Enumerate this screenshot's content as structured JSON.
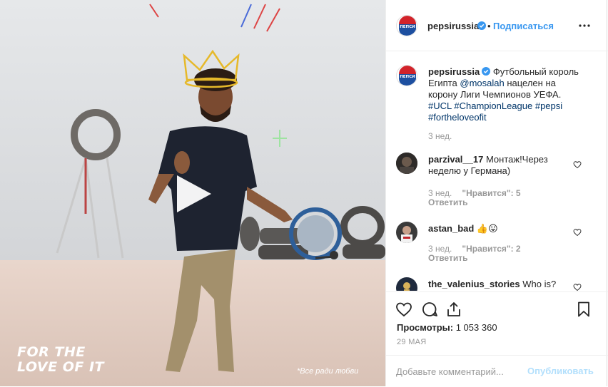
{
  "video": {
    "brand_line1": "FOR THE",
    "brand_line2": "LOVE OF IT",
    "caption": "*Все ради любви"
  },
  "header": {
    "username": "pepsirussia",
    "separator": "•",
    "follow_label": "Подписаться"
  },
  "post": {
    "username": "pepsirussia",
    "caption_text_1": " Футбольный король Египта ",
    "mention": "@mosalah",
    "caption_text_2": " нацелен на корону Лиги Чемпионов УЕФА. ",
    "hashtags": "#UCL #ChampionLeague #pepsi #fortheloveofit",
    "time": "3 нед."
  },
  "comments": [
    {
      "username": "parzival__17",
      "text": " Монтаж!Через неделю у Германа)",
      "time": "3 нед.",
      "likes": "\"Нравится\": 5",
      "reply": "Ответить"
    },
    {
      "username": "astan_bad",
      "text": " 👍😛",
      "time": "3 нед.",
      "likes": "\"Нравится\": 2",
      "reply": "Ответить"
    },
    {
      "username": "the_valenius_stories",
      "text": " Who is?"
    }
  ],
  "actions": {
    "views_label": "Просмотры:",
    "views_count": "1 053 360",
    "date": "29 МАЯ",
    "comment_placeholder": "Добавьте комментарий...",
    "publish_label": "Опубликовать"
  },
  "colors": {
    "accent": "#3897f0",
    "link": "#003569",
    "muted": "#999999",
    "publish_disabled": "#b2dffc"
  },
  "icons": [
    "play-icon",
    "verified-icon",
    "more-options-icon",
    "heart-icon",
    "comment-icon",
    "share-icon",
    "bookmark-icon",
    "pepsi-logo"
  ]
}
